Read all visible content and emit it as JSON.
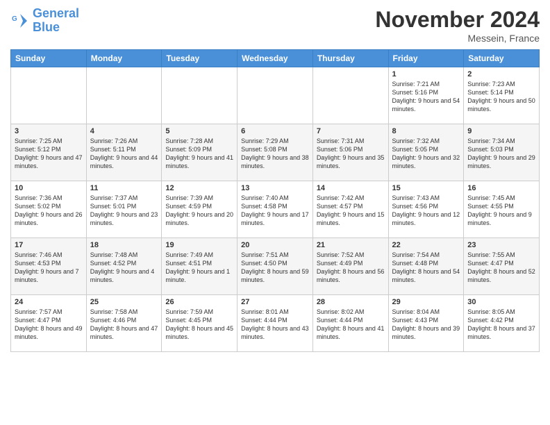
{
  "header": {
    "logo_line1": "General",
    "logo_line2": "Blue",
    "month": "November 2024",
    "location": "Messein, France"
  },
  "weekdays": [
    "Sunday",
    "Monday",
    "Tuesday",
    "Wednesday",
    "Thursday",
    "Friday",
    "Saturday"
  ],
  "weeks": [
    [
      {
        "day": "",
        "info": ""
      },
      {
        "day": "",
        "info": ""
      },
      {
        "day": "",
        "info": ""
      },
      {
        "day": "",
        "info": ""
      },
      {
        "day": "",
        "info": ""
      },
      {
        "day": "1",
        "info": "Sunrise: 7:21 AM\nSunset: 5:16 PM\nDaylight: 9 hours and 54 minutes."
      },
      {
        "day": "2",
        "info": "Sunrise: 7:23 AM\nSunset: 5:14 PM\nDaylight: 9 hours and 50 minutes."
      }
    ],
    [
      {
        "day": "3",
        "info": "Sunrise: 7:25 AM\nSunset: 5:12 PM\nDaylight: 9 hours and 47 minutes."
      },
      {
        "day": "4",
        "info": "Sunrise: 7:26 AM\nSunset: 5:11 PM\nDaylight: 9 hours and 44 minutes."
      },
      {
        "day": "5",
        "info": "Sunrise: 7:28 AM\nSunset: 5:09 PM\nDaylight: 9 hours and 41 minutes."
      },
      {
        "day": "6",
        "info": "Sunrise: 7:29 AM\nSunset: 5:08 PM\nDaylight: 9 hours and 38 minutes."
      },
      {
        "day": "7",
        "info": "Sunrise: 7:31 AM\nSunset: 5:06 PM\nDaylight: 9 hours and 35 minutes."
      },
      {
        "day": "8",
        "info": "Sunrise: 7:32 AM\nSunset: 5:05 PM\nDaylight: 9 hours and 32 minutes."
      },
      {
        "day": "9",
        "info": "Sunrise: 7:34 AM\nSunset: 5:03 PM\nDaylight: 9 hours and 29 minutes."
      }
    ],
    [
      {
        "day": "10",
        "info": "Sunrise: 7:36 AM\nSunset: 5:02 PM\nDaylight: 9 hours and 26 minutes."
      },
      {
        "day": "11",
        "info": "Sunrise: 7:37 AM\nSunset: 5:01 PM\nDaylight: 9 hours and 23 minutes."
      },
      {
        "day": "12",
        "info": "Sunrise: 7:39 AM\nSunset: 4:59 PM\nDaylight: 9 hours and 20 minutes."
      },
      {
        "day": "13",
        "info": "Sunrise: 7:40 AM\nSunset: 4:58 PM\nDaylight: 9 hours and 17 minutes."
      },
      {
        "day": "14",
        "info": "Sunrise: 7:42 AM\nSunset: 4:57 PM\nDaylight: 9 hours and 15 minutes."
      },
      {
        "day": "15",
        "info": "Sunrise: 7:43 AM\nSunset: 4:56 PM\nDaylight: 9 hours and 12 minutes."
      },
      {
        "day": "16",
        "info": "Sunrise: 7:45 AM\nSunset: 4:55 PM\nDaylight: 9 hours and 9 minutes."
      }
    ],
    [
      {
        "day": "17",
        "info": "Sunrise: 7:46 AM\nSunset: 4:53 PM\nDaylight: 9 hours and 7 minutes."
      },
      {
        "day": "18",
        "info": "Sunrise: 7:48 AM\nSunset: 4:52 PM\nDaylight: 9 hours and 4 minutes."
      },
      {
        "day": "19",
        "info": "Sunrise: 7:49 AM\nSunset: 4:51 PM\nDaylight: 9 hours and 1 minute."
      },
      {
        "day": "20",
        "info": "Sunrise: 7:51 AM\nSunset: 4:50 PM\nDaylight: 8 hours and 59 minutes."
      },
      {
        "day": "21",
        "info": "Sunrise: 7:52 AM\nSunset: 4:49 PM\nDaylight: 8 hours and 56 minutes."
      },
      {
        "day": "22",
        "info": "Sunrise: 7:54 AM\nSunset: 4:48 PM\nDaylight: 8 hours and 54 minutes."
      },
      {
        "day": "23",
        "info": "Sunrise: 7:55 AM\nSunset: 4:47 PM\nDaylight: 8 hours and 52 minutes."
      }
    ],
    [
      {
        "day": "24",
        "info": "Sunrise: 7:57 AM\nSunset: 4:47 PM\nDaylight: 8 hours and 49 minutes."
      },
      {
        "day": "25",
        "info": "Sunrise: 7:58 AM\nSunset: 4:46 PM\nDaylight: 8 hours and 47 minutes."
      },
      {
        "day": "26",
        "info": "Sunrise: 7:59 AM\nSunset: 4:45 PM\nDaylight: 8 hours and 45 minutes."
      },
      {
        "day": "27",
        "info": "Sunrise: 8:01 AM\nSunset: 4:44 PM\nDaylight: 8 hours and 43 minutes."
      },
      {
        "day": "28",
        "info": "Sunrise: 8:02 AM\nSunset: 4:44 PM\nDaylight: 8 hours and 41 minutes."
      },
      {
        "day": "29",
        "info": "Sunrise: 8:04 AM\nSunset: 4:43 PM\nDaylight: 8 hours and 39 minutes."
      },
      {
        "day": "30",
        "info": "Sunrise: 8:05 AM\nSunset: 4:42 PM\nDaylight: 8 hours and 37 minutes."
      }
    ]
  ]
}
